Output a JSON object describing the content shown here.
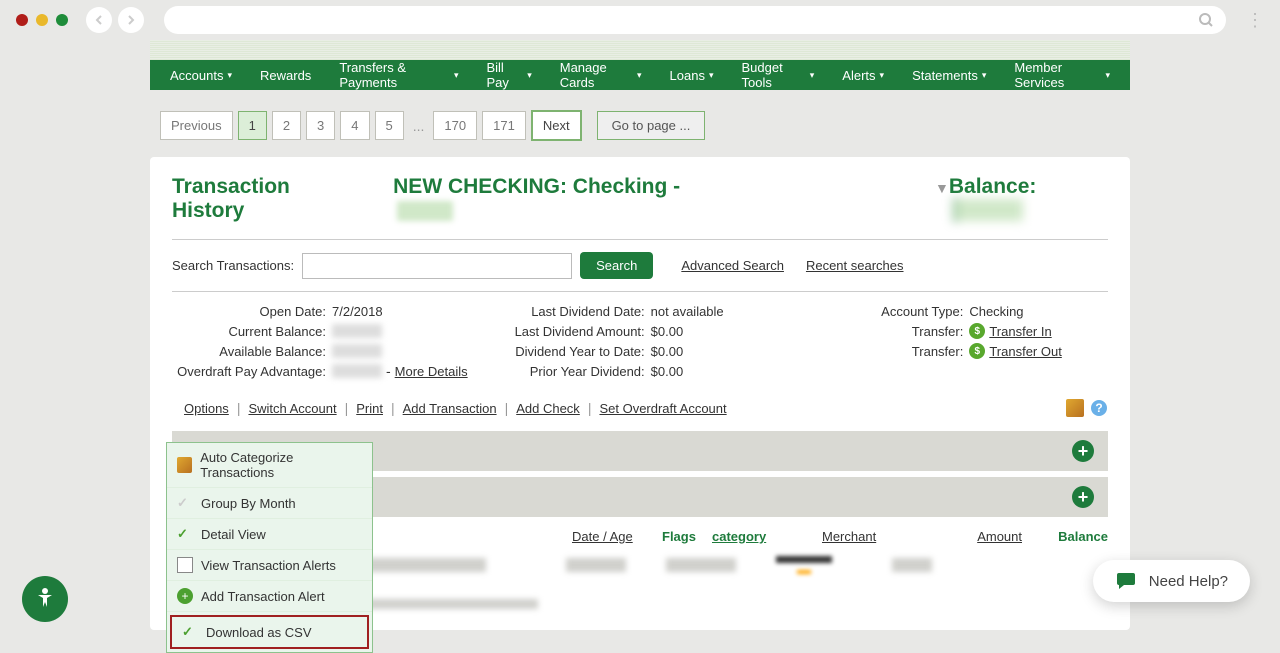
{
  "nav": {
    "items": [
      "Accounts",
      "Rewards",
      "Transfers & Payments",
      "Bill Pay",
      "Manage Cards",
      "Loans",
      "Budget Tools",
      "Alerts",
      "Statements",
      "Member Services"
    ]
  },
  "pagination": {
    "previous": "Previous",
    "pages": [
      "1",
      "2",
      "3",
      "4",
      "5",
      "170",
      "171"
    ],
    "next": "Next",
    "goto": "Go to page ..."
  },
  "header": {
    "title": "Transaction History",
    "account_name": "NEW CHECKING: Checking -",
    "balance_label": "Balance:"
  },
  "search": {
    "label": "Search Transactions:",
    "button": "Search",
    "advanced": "Advanced Search",
    "recent": "Recent searches"
  },
  "details": {
    "open_date_label": "Open Date:",
    "open_date": "7/2/2018",
    "current_balance_label": "Current Balance:",
    "available_balance_label": "Available Balance:",
    "overdraft_label": "Overdraft Pay Advantage:",
    "more_details": "More Details",
    "last_div_date_label": "Last Dividend Date:",
    "last_div_date": "not available",
    "last_div_amt_label": "Last Dividend Amount:",
    "last_div_amt": "$0.00",
    "div_ytd_label": "Dividend Year to Date:",
    "div_ytd": "$0.00",
    "prior_year_label": "Prior Year Dividend:",
    "prior_year": "$0.00",
    "account_type_label": "Account Type:",
    "account_type": "Checking",
    "transfer_label": "Transfer:",
    "transfer_in": "Transfer In",
    "transfer_out": "Transfer Out"
  },
  "action_bar": {
    "options": "Options",
    "switch": "Switch Account",
    "print": "Print",
    "add_tx": "Add Transaction",
    "add_check": "Add Check",
    "overdraft": "Set Overdraft Account"
  },
  "options_menu": {
    "auto_cat": "Auto Categorize Transactions",
    "group": "Group By Month",
    "detail": "Detail View",
    "view_alerts": "View Transaction Alerts",
    "add_alert": "Add Transaction Alert",
    "download": "Download as CSV"
  },
  "columns": {
    "date": "Date / Age",
    "flags": "Flags",
    "category": "category",
    "merchant": "Merchant",
    "amount": "Amount",
    "balance": "Balance"
  },
  "help": {
    "label": "Need Help?"
  }
}
